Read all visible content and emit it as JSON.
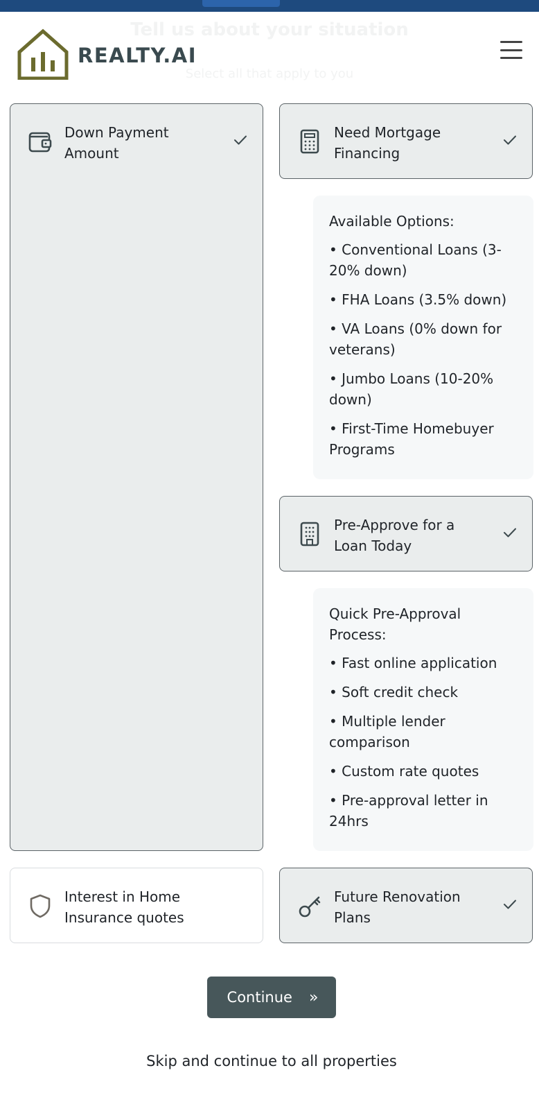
{
  "background_text": {
    "title": "Tell us about your situation",
    "subtitle": "Select all that apply to you"
  },
  "brand": {
    "name": "REALTY.AI",
    "logo_color": "#6b6b2e",
    "text_color": "#3a4a4f"
  },
  "cards": [
    {
      "label": "Down Payment Amount",
      "icon": "wallet-icon",
      "selected": true
    },
    {
      "label": "Need Mortgage Financing",
      "icon": "calculator-icon",
      "selected": true
    },
    {
      "label": "Pre-Approve for a Loan Today",
      "icon": "building-icon",
      "selected": true
    },
    {
      "label": "Interest in Home Insurance quotes",
      "icon": "shield-icon",
      "selected": false
    },
    {
      "label": "Future Renovation Plans",
      "icon": "key-icon",
      "selected": true
    }
  ],
  "mortgage_info": {
    "title": "Available Options:",
    "items": [
      "• Conventional Loans (3-20% down)",
      "• FHA Loans (3.5% down)",
      "• VA Loans (0% down for veterans)",
      "• Jumbo Loans (10-20% down)",
      "• First-Time Homebuyer Programs"
    ]
  },
  "preapproval_info": {
    "title": "Quick Pre-Approval Process:",
    "items": [
      "• Fast online application",
      "• Soft credit check",
      "• Multiple lender comparison",
      "• Custom rate quotes",
      "• Pre-approval letter in 24hrs"
    ]
  },
  "actions": {
    "continue_label": "Continue",
    "continue_icon": "»",
    "skip_label": "Skip and continue to all properties"
  },
  "colors": {
    "header_bar": "#1e4a7e",
    "selected_card_bg": "#eaeded",
    "primary_button": "#47575a"
  }
}
